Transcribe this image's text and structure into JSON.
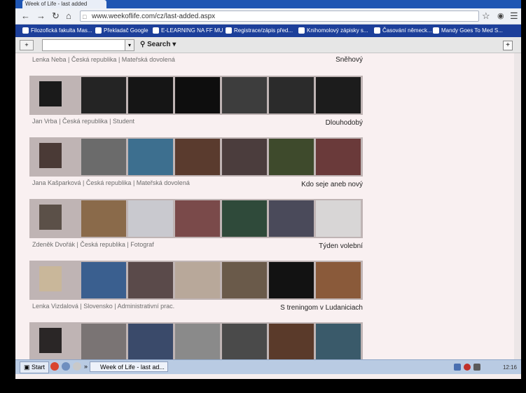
{
  "browser": {
    "tab_title": "Week of Life - last added",
    "url": "www.weekoflife.com/cz/last-added.aspx"
  },
  "bookmarks": [
    {
      "label": "Filozofická fakulta Mas..."
    },
    {
      "label": "Překladač Google"
    },
    {
      "label": "E-LEARNING NA FF MU"
    },
    {
      "label": "Registrace/zápis před..."
    },
    {
      "label": "Knihomolový zápisky s..."
    },
    {
      "label": "Časování německ..."
    },
    {
      "label": "Mandy Goes To Med S..."
    }
  ],
  "toolbar": {
    "drop_label": "+",
    "search_label": "Search",
    "add_label": "+"
  },
  "entries": [
    {
      "author": "Lenka Neba",
      "country": "Česká republika",
      "occupation": "Mateřská dovolená",
      "title": "Sněhový"
    },
    {
      "author": "Jan Vrba",
      "country": "Česká republika",
      "occupation": "Student",
      "title": "Dlouhodobý"
    },
    {
      "author": "Jana Kašparková",
      "country": "Česká republika",
      "occupation": "Mateřská dovolená",
      "title": "Kdo seje aneb nový"
    },
    {
      "author": "Zdeněk Dvořák",
      "country": "Česká republika",
      "occupation": "Fotograf",
      "title": "Týden volební"
    },
    {
      "author": "Lenka Vizdalová",
      "country": "Slovensko",
      "occupation": "Administrativní prac.",
      "title": "S treningom v Ludaniciach"
    }
  ],
  "taskbar": {
    "start_label": "Start",
    "window_label": "Week of Life - last ad...",
    "clock": "12:16"
  },
  "colors": {
    "titlebar": "#1f56b3",
    "bookmarks_bar": "#1c3f9a",
    "page_bg": "#f9f0f1",
    "strip_bg": "#bfb4b4"
  }
}
